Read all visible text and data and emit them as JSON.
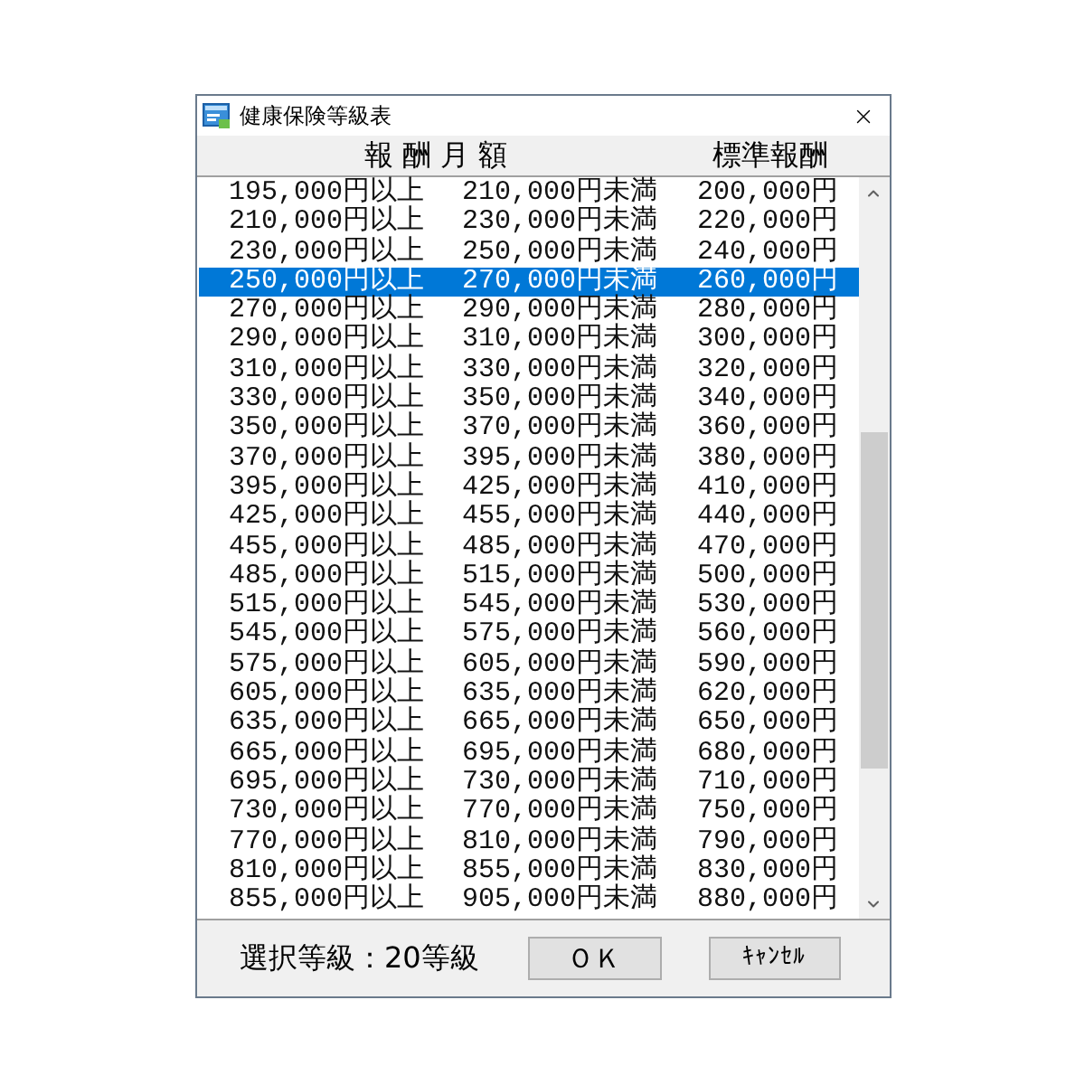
{
  "window": {
    "title": "健康保険等級表"
  },
  "headers": [
    {
      "label": "報 酬 月 額"
    },
    {
      "label": "標準報酬"
    }
  ],
  "rows": [
    {
      "from": "195,000円以上",
      "to": "210,000円未満",
      "standard": "200,000円",
      "selected": false
    },
    {
      "from": "210,000円以上",
      "to": "230,000円未満",
      "standard": "220,000円",
      "selected": false
    },
    {
      "from": "230,000円以上",
      "to": "250,000円未満",
      "standard": "240,000円",
      "selected": false
    },
    {
      "from": "250,000円以上",
      "to": "270,000円未満",
      "standard": "260,000円",
      "selected": true
    },
    {
      "from": "270,000円以上",
      "to": "290,000円未満",
      "standard": "280,000円",
      "selected": false
    },
    {
      "from": "290,000円以上",
      "to": "310,000円未満",
      "standard": "300,000円",
      "selected": false
    },
    {
      "from": "310,000円以上",
      "to": "330,000円未満",
      "standard": "320,000円",
      "selected": false
    },
    {
      "from": "330,000円以上",
      "to": "350,000円未満",
      "standard": "340,000円",
      "selected": false
    },
    {
      "from": "350,000円以上",
      "to": "370,000円未満",
      "standard": "360,000円",
      "selected": false
    },
    {
      "from": "370,000円以上",
      "to": "395,000円未満",
      "standard": "380,000円",
      "selected": false
    },
    {
      "from": "395,000円以上",
      "to": "425,000円未満",
      "standard": "410,000円",
      "selected": false
    },
    {
      "from": "425,000円以上",
      "to": "455,000円未満",
      "standard": "440,000円",
      "selected": false
    },
    {
      "from": "455,000円以上",
      "to": "485,000円未満",
      "standard": "470,000円",
      "selected": false
    },
    {
      "from": "485,000円以上",
      "to": "515,000円未満",
      "standard": "500,000円",
      "selected": false
    },
    {
      "from": "515,000円以上",
      "to": "545,000円未満",
      "standard": "530,000円",
      "selected": false
    },
    {
      "from": "545,000円以上",
      "to": "575,000円未満",
      "standard": "560,000円",
      "selected": false
    },
    {
      "from": "575,000円以上",
      "to": "605,000円未満",
      "standard": "590,000円",
      "selected": false
    },
    {
      "from": "605,000円以上",
      "to": "635,000円未満",
      "standard": "620,000円",
      "selected": false
    },
    {
      "from": "635,000円以上",
      "to": "665,000円未満",
      "standard": "650,000円",
      "selected": false
    },
    {
      "from": "665,000円以上",
      "to": "695,000円未満",
      "standard": "680,000円",
      "selected": false
    },
    {
      "from": "695,000円以上",
      "to": "730,000円未満",
      "standard": "710,000円",
      "selected": false
    },
    {
      "from": "730,000円以上",
      "to": "770,000円未満",
      "standard": "750,000円",
      "selected": false
    },
    {
      "from": "770,000円以上",
      "to": "810,000円未満",
      "standard": "790,000円",
      "selected": false
    },
    {
      "from": "810,000円以上",
      "to": "855,000円未満",
      "standard": "830,000円",
      "selected": false
    },
    {
      "from": "855,000円以上",
      "to": "905,000円未満",
      "standard": "880,000円",
      "selected": false
    }
  ],
  "status": "選択等級：20等級",
  "buttons": [
    {
      "label": "ＯＫ"
    },
    {
      "label": "ｷｬﾝｾﾙ"
    }
  ]
}
